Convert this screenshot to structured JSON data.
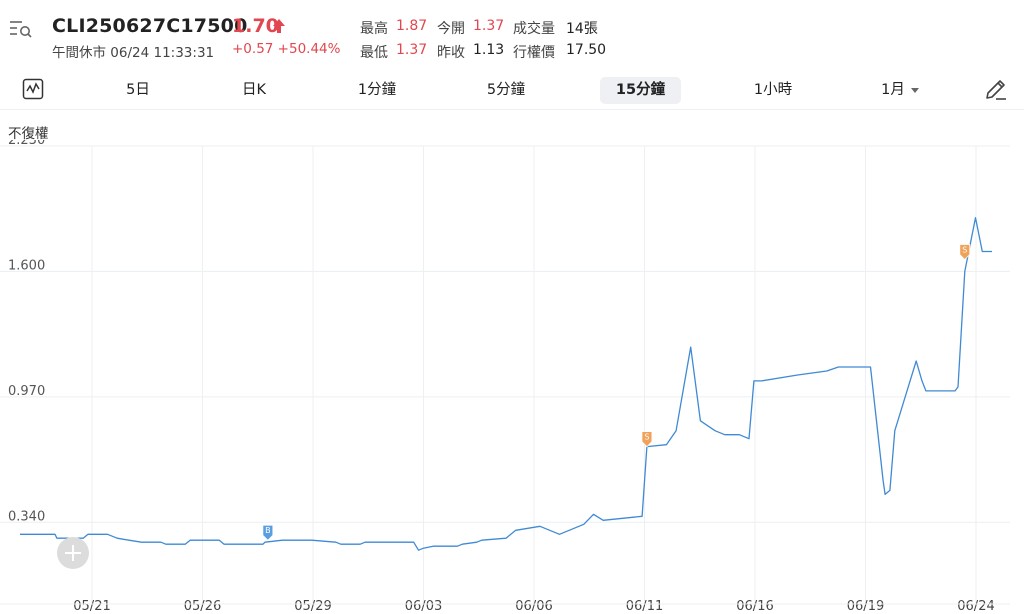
{
  "header": {
    "symbol": "CLI250627C17500",
    "price": "1.70",
    "status": "午間休市",
    "datetime": "06/24 11:33:31",
    "change": "+0.57",
    "change_pct": "+50.44%",
    "stats": {
      "high_label": "最高",
      "high": "1.87",
      "open_label": "今開",
      "open": "1.37",
      "volume_label": "成交量",
      "volume": "14張",
      "low_label": "最低",
      "low": "1.37",
      "prev_close_label": "昨收",
      "prev_close": "1.13",
      "strike_label": "行權價",
      "strike": "17.50"
    }
  },
  "tabs": [
    "5日",
    "日K",
    "1分鐘",
    "5分鐘",
    "15分鐘",
    "1小時",
    "1月"
  ],
  "active_tab": "15分鐘",
  "adjust_label": "不復權",
  "colors": {
    "line": "#3f8ad4",
    "up": "#e2474f",
    "sell_marker": "#f0a15a",
    "buy_marker": "#5a9ee0",
    "grid": "#eceff3"
  },
  "chart_data": {
    "type": "line",
    "yticks": [
      "2.230",
      "1.600",
      "0.970",
      "0.340"
    ],
    "ylim": [
      0.0,
      2.23
    ],
    "xtick_labels": [
      "05/21",
      "05/26",
      "05/29",
      "06/03",
      "06/06",
      "06/11",
      "06/16",
      "06/19",
      "06/24"
    ],
    "grid": true,
    "series": [
      {
        "x": [
          0,
          0.036,
          0.038,
          0.065,
          0.07,
          0.09,
          0.1,
          0.112,
          0.125,
          0.145,
          0.15,
          0.17,
          0.175,
          0.205,
          0.21,
          0.25,
          0.252,
          0.27,
          0.3,
          0.325,
          0.33,
          0.35,
          0.355,
          0.405,
          0.41,
          0.415,
          0.425,
          0.45,
          0.455,
          0.47,
          0.475,
          0.5,
          0.51,
          0.535,
          0.545,
          0.555,
          0.565,
          0.58,
          0.59,
          0.6,
          0.62,
          0.64,
          0.645,
          0.665,
          0.675,
          0.69,
          0.7,
          0.715,
          0.725,
          0.74,
          0.75,
          0.755,
          0.763,
          0.8,
          0.83,
          0.842,
          0.848,
          0.875,
          0.888,
          0.89,
          0.895,
          0.9,
          0.922,
          0.928,
          0.932,
          0.935,
          0.962,
          0.965,
          0.972,
          0.983,
          0.99,
          1.0
        ],
        "values": [
          0.28,
          0.28,
          0.26,
          0.26,
          0.28,
          0.28,
          0.26,
          0.25,
          0.24,
          0.24,
          0.23,
          0.23,
          0.25,
          0.25,
          0.23,
          0.23,
          0.24,
          0.25,
          0.25,
          0.24,
          0.23,
          0.23,
          0.24,
          0.24,
          0.2,
          0.21,
          0.22,
          0.22,
          0.23,
          0.24,
          0.25,
          0.26,
          0.3,
          0.32,
          0.3,
          0.28,
          0.3,
          0.33,
          0.38,
          0.35,
          0.36,
          0.37,
          0.72,
          0.73,
          0.8,
          1.22,
          0.85,
          0.8,
          0.78,
          0.78,
          0.76,
          1.05,
          1.05,
          1.08,
          1.1,
          1.12,
          1.12,
          1.12,
          0.55,
          0.48,
          0.5,
          0.8,
          1.15,
          1.05,
          1.0,
          1.0,
          1.0,
          1.02,
          1.6,
          1.87,
          1.7,
          1.7
        ]
      }
    ],
    "markers": [
      {
        "x": 0.255,
        "y": 0.25,
        "label": "B",
        "type": "buy"
      },
      {
        "x": 0.645,
        "y": 0.72,
        "label": "S",
        "type": "sell"
      },
      {
        "x": 0.972,
        "y": 1.66,
        "label": "S",
        "type": "sell"
      }
    ]
  }
}
